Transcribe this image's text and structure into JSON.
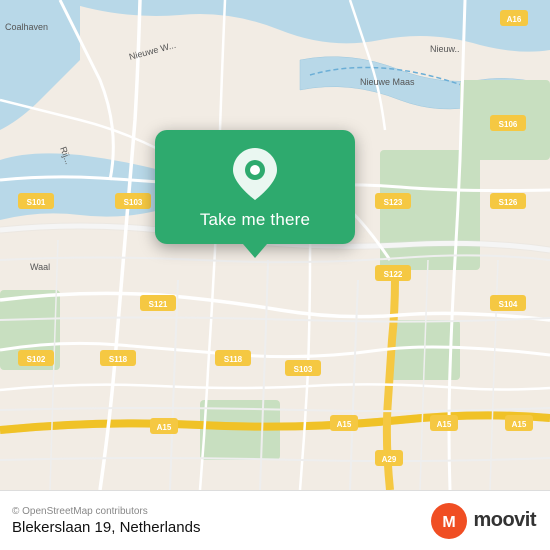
{
  "map": {
    "popup": {
      "label": "Take me there"
    }
  },
  "footer": {
    "copyright": "© OpenStreetMap contributors",
    "location": "Blekerslaan 19, Netherlands"
  },
  "moovit": {
    "text": "moovit"
  }
}
